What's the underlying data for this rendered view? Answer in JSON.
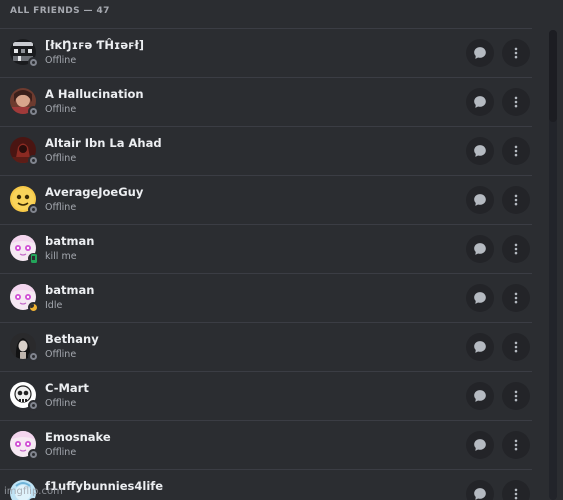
{
  "header": {
    "title": "ALL FRIENDS — 47"
  },
  "friends": [
    {
      "name": "[łĸŊɪꜰə ƬĤɪəꜰł]",
      "status_text": "Offline",
      "presence": "offline",
      "avatar": "avatar-pattern-dark"
    },
    {
      "name": "A Hallucination",
      "status_text": "Offline",
      "presence": "offline",
      "avatar": "avatar-portrait-brown"
    },
    {
      "name": "Altair Ibn La Ahad",
      "status_text": "Offline",
      "presence": "offline",
      "avatar": "avatar-portrait-red"
    },
    {
      "name": "AverageJoeGuy",
      "status_text": "Offline",
      "presence": "offline",
      "avatar": "avatar-face-yellow"
    },
    {
      "name": "batman",
      "status_text": "kill me",
      "presence": "mobile",
      "avatar": "avatar-anime-pink"
    },
    {
      "name": "batman",
      "status_text": "Idle",
      "presence": "idle",
      "avatar": "avatar-anime-pink"
    },
    {
      "name": "Bethany",
      "status_text": "Offline",
      "presence": "offline",
      "avatar": "avatar-portrait-dark"
    },
    {
      "name": "C-Mart",
      "status_text": "Offline",
      "presence": "offline",
      "avatar": "avatar-skull-white"
    },
    {
      "name": "Emosnake",
      "status_text": "Offline",
      "presence": "offline",
      "avatar": "avatar-anime-pink"
    },
    {
      "name": "f1uffybunnies4life",
      "status_text": "",
      "presence": "offline",
      "avatar": "avatar-blue-light"
    }
  ],
  "watermark": "imgflip.com",
  "colors": {
    "background": "#2b2d31",
    "row_divider": "#3b3d44",
    "name_text": "#eceef1",
    "sub_text": "#a4a8af",
    "button_bg": "#232428",
    "offline": "#80848e",
    "mobile": "#23a55a",
    "idle": "#f0b232"
  },
  "icons": {
    "message": "chat-bubble-icon",
    "more": "vertical-dots-icon"
  }
}
